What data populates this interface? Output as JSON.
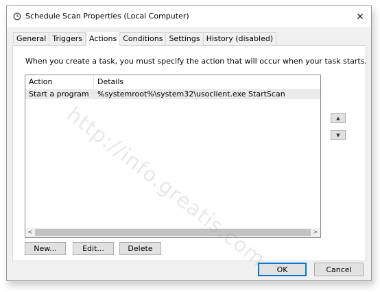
{
  "window": {
    "title": "Schedule Scan Properties (Local Computer)",
    "close_glyph": "✕"
  },
  "tabs": [
    {
      "label": "General"
    },
    {
      "label": "Triggers"
    },
    {
      "label": "Actions",
      "active": true
    },
    {
      "label": "Conditions"
    },
    {
      "label": "Settings"
    },
    {
      "label": "History (disabled)"
    }
  ],
  "panel": {
    "instruction": "When you create a task, you must specify the action that will occur when your task starts."
  },
  "list": {
    "columns": [
      "Action",
      "Details"
    ],
    "rows": [
      {
        "action": "Start a program",
        "details": "%systemroot%\\system32\\usoclient.exe StartScan"
      }
    ]
  },
  "move": {
    "up_glyph": "▲",
    "down_glyph": "▼"
  },
  "buttons": {
    "new": "New...",
    "edit": "Edit...",
    "delete": "Delete",
    "ok": "OK",
    "cancel": "Cancel"
  },
  "scroll": {
    "left_glyph": "<",
    "right_glyph": ">"
  },
  "watermark": "http://info.greatis.com"
}
